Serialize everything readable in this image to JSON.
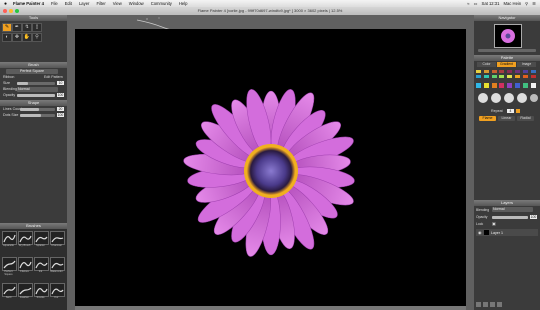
{
  "menubar": {
    "items": [
      "Flame Painter 4",
      "File",
      "Edit",
      "Layer",
      "Filter",
      "View",
      "Window",
      "Community",
      "Help"
    ],
    "right_time": "Sat 12:31",
    "right_user": "Mac Hein"
  },
  "window": {
    "title": "Flame Painter 4 [vorlie.jpg - 99ff70d697-windfo9.jpg* ] 3000 × 3602 pixels | 12.5%"
  },
  "left": {
    "tools_title": "Tools",
    "tool_icons": [
      "brush-icon",
      "pen-icon",
      "dropper-icon",
      "eraser-icon",
      "gradient-icon",
      "move-icon",
      "hand-icon",
      "zoom-icon"
    ],
    "brush_title": "Brush",
    "brush_preset": "Perfect Square",
    "ribbon_label": "Ribbon",
    "ribbon_value": "Edit Pattern",
    "size_label": "Size",
    "size_value": "10",
    "size_level": 0.3,
    "blending_label": "Blending",
    "blending_value": "Normal",
    "opacity_label": "Opacity",
    "opacity_value": "100",
    "opacity_level": 1.0,
    "shape_title": "Shape",
    "line_count_label": "Lines Count",
    "line_count_value": "20",
    "line_count_level": 0.55,
    "dots_size_label": "Dots Size",
    "dots_size_value": "100",
    "dots_size_level": 0.6,
    "brushes_title": "Brushes",
    "brushes": [
      "Aquarelle",
      "Dry Brush",
      "Splatter",
      "Charcoal",
      "Perfect Square",
      "Flames",
      "Ink",
      "Watercolor",
      "Swirl",
      "Feather",
      "Smoke",
      "Fur"
    ]
  },
  "right": {
    "navigator_title": "Navigator",
    "palette_title": "Palette",
    "palette_tabs": [
      "Color",
      "Gradient",
      "Image"
    ],
    "palette_active_tab": "Gradient",
    "swatches": [
      "#e8d040",
      "#d89a30",
      "#c86030",
      "#a83c40",
      "#8a2a55",
      "#70307a",
      "#5040a0",
      "#3870c0",
      "#2aa0d0",
      "#30c8b0",
      "#60d070",
      "#a0e050",
      "#e0e050",
      "#f0a020",
      "#e06020",
      "#c03030"
    ],
    "brush_cols": [
      "#30b8e8",
      "#e8e030",
      "#e08020",
      "#d03060",
      "#9040c0",
      "#4060d0",
      "#40c080",
      "#f0f0f0"
    ],
    "repeat_label": "Repeat",
    "repeat_value": "4",
    "mode_buttons": [
      "Flame",
      "Linear",
      "Radial"
    ],
    "mode_active": "Flame",
    "layers_title": "Layers",
    "layer_blending_label": "Blending",
    "layer_blending_value": "Normal",
    "layer_opacity_label": "Opacity",
    "layer_opacity_value": "100",
    "layer_lock_label": "Lock",
    "layers": [
      "Layer 1"
    ]
  },
  "colors": {
    "accent": "#f0a020",
    "canvas": "#000000",
    "petal": "#d86fe0",
    "center": "#5a4a9a"
  }
}
